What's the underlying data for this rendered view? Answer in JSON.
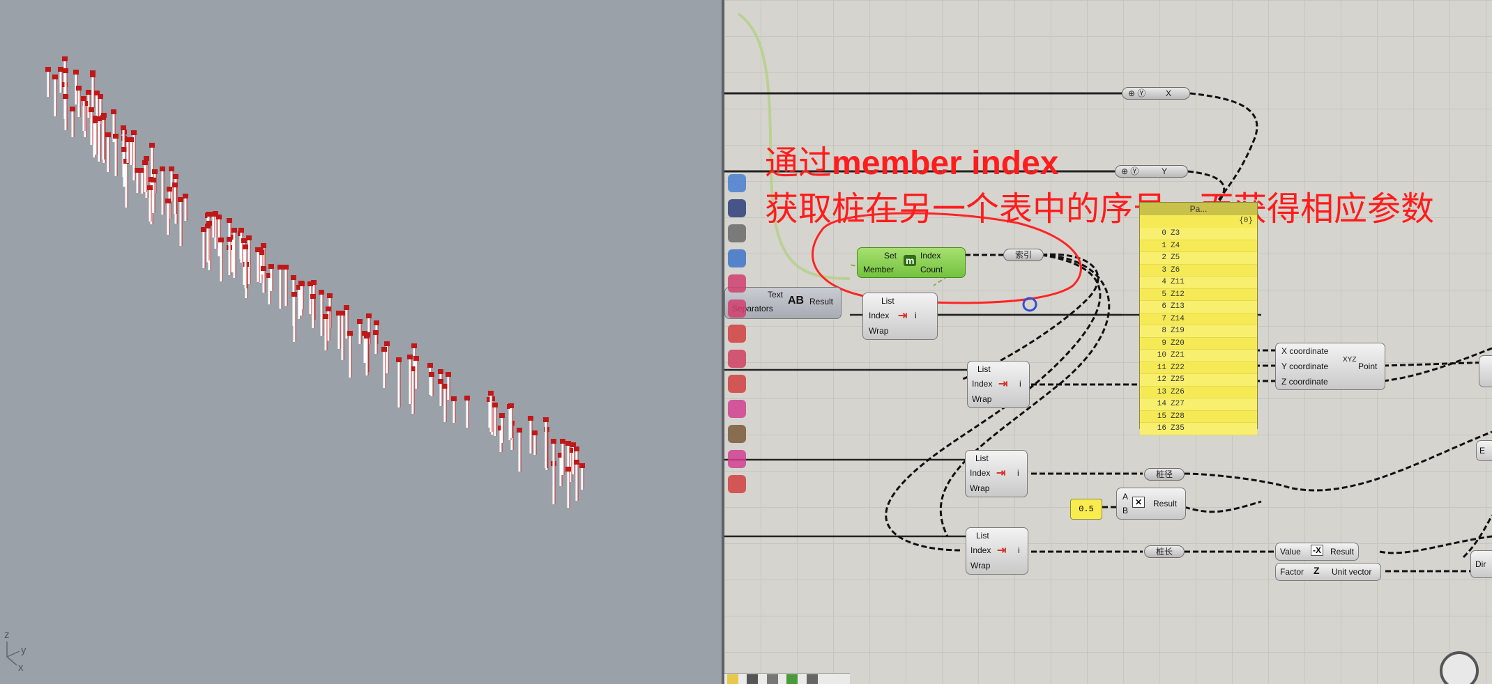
{
  "viewport": {
    "background": "#9aa1a9",
    "axis_labels": {
      "z": "z",
      "y": "y",
      "x": "x"
    }
  },
  "toolbar_icons": [
    "cluster-icon",
    "gha-icon",
    "grid-icon",
    "navigate-icon",
    "box-icon",
    "twist-icon",
    "arrow-icon",
    "hand-icon",
    "cross-icon",
    "circle-icon",
    "palette-icon",
    "table-icon",
    "prohibit-icon"
  ],
  "components": {
    "text_join": {
      "input1": "Text",
      "input2": "Separators",
      "output": "Result",
      "icon": "AB"
    },
    "member_index": {
      "input1": "Set",
      "input2": "Member",
      "output1": "Index",
      "output2": "Count",
      "icon": "m"
    },
    "list_item_1": {
      "title": "List",
      "index": "Index",
      "wrap": "Wrap",
      "output": "i"
    },
    "list_item_2": {
      "title": "List",
      "index": "Index",
      "wrap": "Wrap",
      "output": "i"
    },
    "list_item_3": {
      "title": "List",
      "index": "Index",
      "wrap": "Wrap",
      "output": "i"
    },
    "list_item_4": {
      "title": "List",
      "index": "Index",
      "wrap": "Wrap",
      "output": "i"
    },
    "construct_point": {
      "x": "X coordinate",
      "y": "Y coordinate",
      "z": "Z coordinate",
      "output": "Point",
      "icon": "XYZ"
    },
    "multiply": {
      "a": "A",
      "b": "B",
      "output": "Result"
    },
    "negative": {
      "input": "Value",
      "output": "Result",
      "icon": "-X"
    },
    "unit_z": {
      "input": "Factor",
      "output": "Unit vector",
      "icon": "Z"
    }
  },
  "params": {
    "x": "X",
    "y": "Y",
    "index_param": "索引",
    "radius_param": "桩径",
    "length_param": "桩长"
  },
  "number_slider": {
    "value": "0.5"
  },
  "panel": {
    "title": "Pa...",
    "path": "{0}",
    "rows": [
      {
        "i": "0",
        "v": "Z3"
      },
      {
        "i": "1",
        "v": "Z4"
      },
      {
        "i": "2",
        "v": "Z5"
      },
      {
        "i": "3",
        "v": "Z6"
      },
      {
        "i": "4",
        "v": "Z11"
      },
      {
        "i": "5",
        "v": "Z12"
      },
      {
        "i": "6",
        "v": "Z13"
      },
      {
        "i": "7",
        "v": "Z14"
      },
      {
        "i": "8",
        "v": "Z19"
      },
      {
        "i": "9",
        "v": "Z20"
      },
      {
        "i": "10",
        "v": "Z21"
      },
      {
        "i": "11",
        "v": "Z22"
      },
      {
        "i": "12",
        "v": "Z25"
      },
      {
        "i": "13",
        "v": "Z26"
      },
      {
        "i": "14",
        "v": "Z27"
      },
      {
        "i": "15",
        "v": "Z28"
      },
      {
        "i": "16",
        "v": "Z35"
      }
    ]
  },
  "annotation": {
    "line1_prefix": "通过",
    "line1_bold": "member index",
    "line2": "获取桩在另一个表中的序号，而获得相应参数",
    "color": "#ff1c1c"
  },
  "edge_labels": {
    "right_top": "E",
    "right_bottom": "Dir"
  }
}
